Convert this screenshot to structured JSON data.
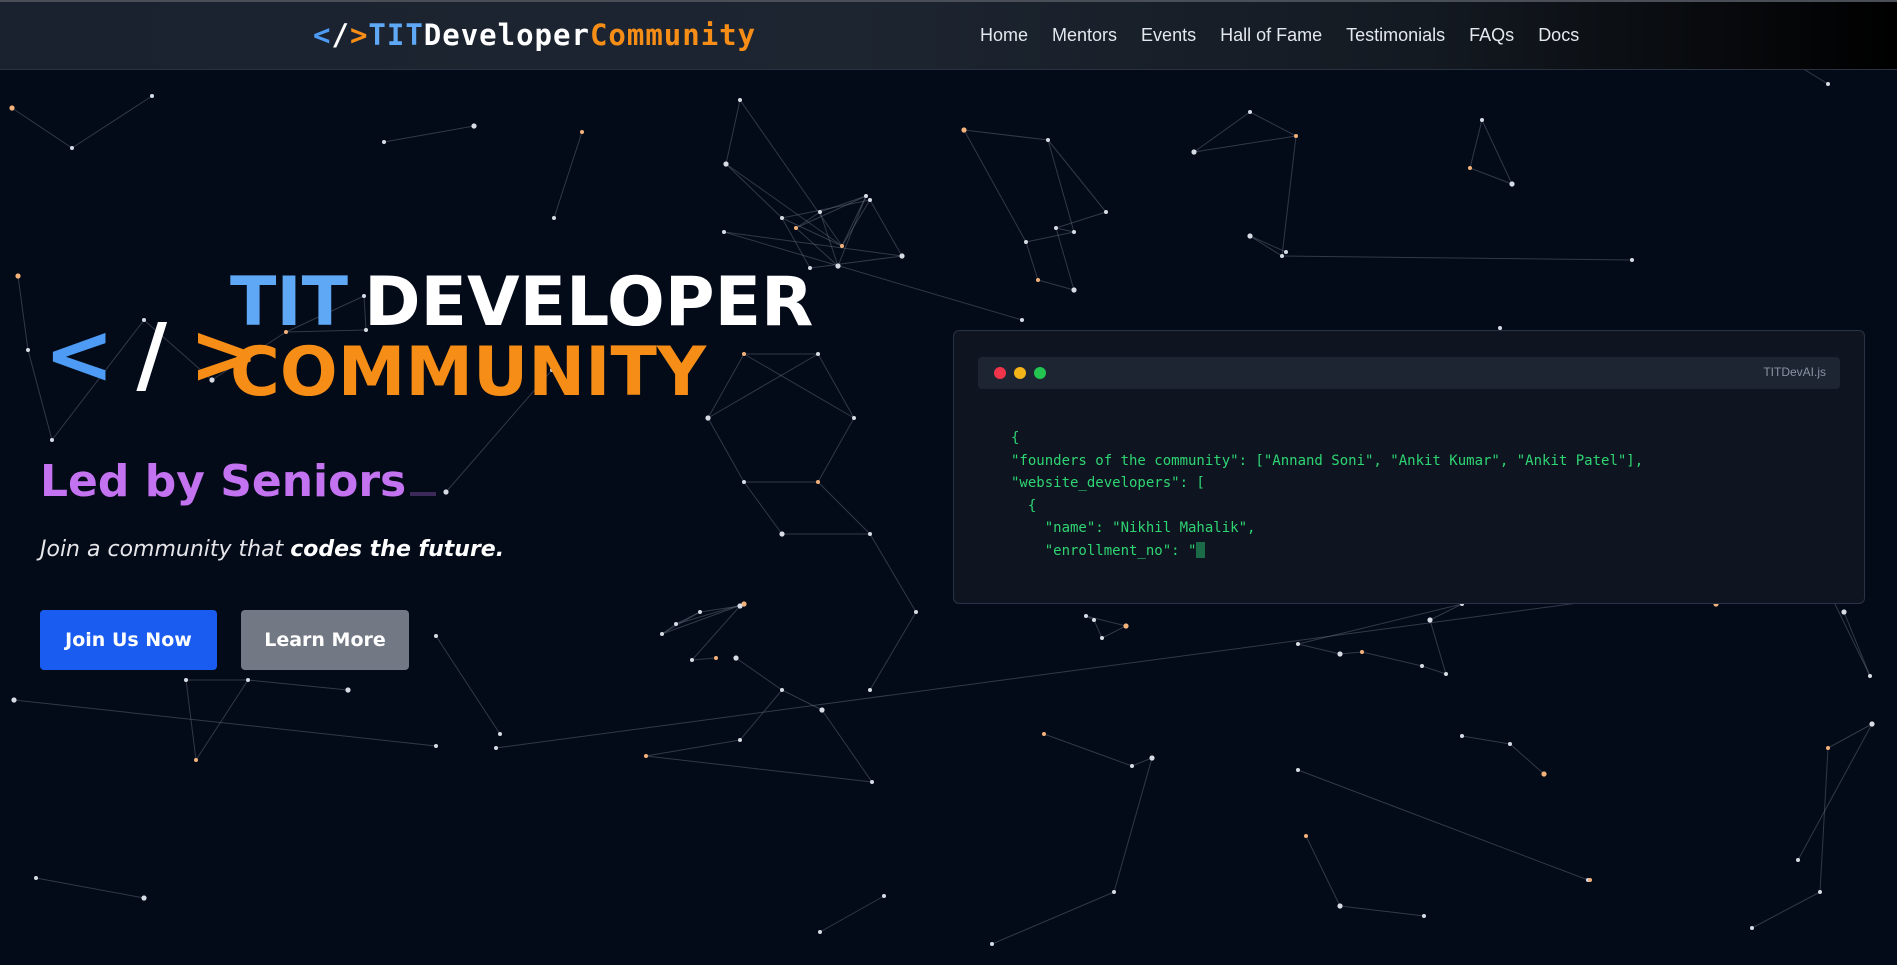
{
  "navbar": {
    "logo": {
      "bracket_open": "<",
      "slash": "/",
      "bracket_close": ">",
      "part1": "TIT",
      "part2": "Developer",
      "part3": "Community"
    },
    "links": [
      "Home",
      "Mentors",
      "Events",
      "Hall of Fame",
      "Testimonials",
      "FAQs",
      "Docs"
    ]
  },
  "hero": {
    "mark": {
      "open": "<",
      "slash": "/",
      "close": ">"
    },
    "title_line1_a": "TIT",
    "title_line1_b": "DEVELOPER",
    "title_line2": "COMMUNITY",
    "tagline": "Led by Seniors",
    "subtitle_a": "Join a community that ",
    "subtitle_b": "codes the future.",
    "primary_button": "Join Us Now",
    "secondary_button": "Learn More"
  },
  "code_window": {
    "filename": "TITDevAI.js",
    "lines": [
      "{",
      "\"founders of the community\": [\"Annand Soni\", \"Ankit Kumar\", \"Ankit Patel\"],",
      "\"website_developers\": [",
      "  {",
      "    \"name\": \"Nikhil Mahalik\",",
      "    \"enrollment_no\": \""
    ]
  },
  "colors": {
    "background": "#030a18",
    "brand_blue": "#4d9bf4",
    "brand_orange": "#f58d16",
    "tagline_purple": "#c373f0",
    "primary_button": "#1a5cf0",
    "secondary_button": "#737984",
    "code_green": "#2ed573"
  }
}
